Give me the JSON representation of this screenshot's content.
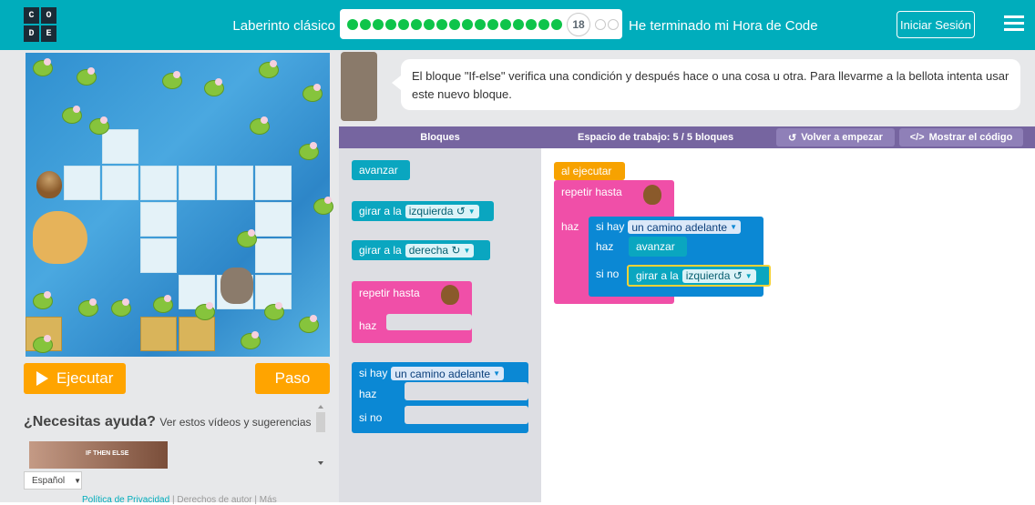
{
  "header": {
    "logo_letters": [
      "C",
      "O",
      "D",
      "E"
    ],
    "level_title": "Laberinto clásico",
    "current_level": "18",
    "finished_label": "He terminado mi Hora de Code",
    "signin_label": "Iniciar Sesión",
    "progress": {
      "completed": 17,
      "current": 18,
      "remaining": 2
    }
  },
  "game": {
    "run_label": "Ejecutar",
    "step_label": "Paso"
  },
  "help": {
    "title": "¿Necesitas ayuda?",
    "subtitle": "Ver estos vídeos y sugerencias",
    "video_label": "IF THEN ELSE"
  },
  "footer": {
    "language": "Español",
    "privacy": "Política de Privacidad",
    "copyright": "Derechos de autor",
    "more": "Más"
  },
  "instructions": {
    "text": "El bloque \"If-else\" verifica una condición y después hace o una cosa u otra. Para llevarme a la bellota intenta usar este nuevo bloque."
  },
  "editor": {
    "toolbox_header": "Bloques",
    "workspace_header": "Espacio de trabajo: 5 / 5 bloques",
    "reset_label": "Volver a empezar",
    "show_code_label": "Mostrar el código"
  },
  "toolbox": {
    "forward": "avanzar",
    "turn_prefix": "girar a la",
    "left": "izquierda ↺",
    "right": "derecha ↻",
    "repeat_until": "repetir hasta",
    "do": "haz",
    "if_path": "si hay",
    "path_ahead": "un camino adelante",
    "else": "si no"
  },
  "workspace": {
    "when_run": "al ejecutar",
    "repeat_until": "repetir hasta",
    "do": "haz",
    "if_path": "si hay",
    "path_ahead": "un camino adelante",
    "inner_do": "haz",
    "forward": "avanzar",
    "else": "si no",
    "turn_prefix": "girar a la",
    "left": "izquierda ↺"
  },
  "colors": {
    "brand": "#00adbc",
    "action_button": "#ffa400",
    "header_purple": "#7665a0",
    "movement_block": "#0aa6c0",
    "loop_block": "#f04fa8",
    "logic_block": "#0b88d4",
    "event_block": "#f7a200"
  }
}
